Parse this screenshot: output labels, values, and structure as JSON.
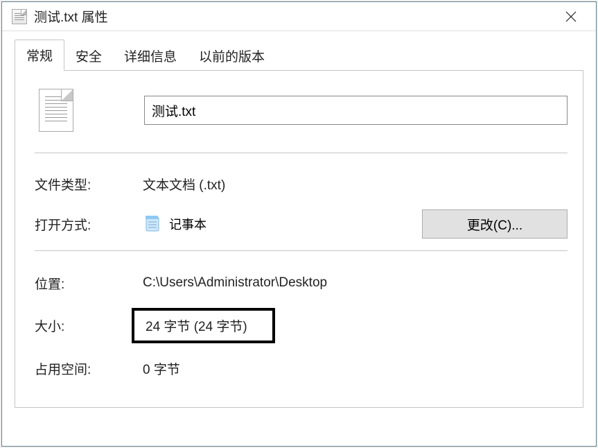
{
  "titlebar": {
    "title": "测试.txt 属性"
  },
  "tabs": {
    "general": "常规",
    "security": "安全",
    "details": "详细信息",
    "previous": "以前的版本"
  },
  "general": {
    "filename": "测试.txt",
    "labels": {
      "filetype": "文件类型:",
      "opens_with": "打开方式:",
      "location": "位置:",
      "size": "大小:",
      "size_on_disk": "占用空间:"
    },
    "values": {
      "filetype": "文本文档 (.txt)",
      "opens_with_app": "记事本",
      "location": "C:\\Users\\Administrator\\Desktop",
      "size": "24 字节 (24 字节)",
      "size_on_disk": "0 字节"
    },
    "change_button": "更改(C)..."
  }
}
